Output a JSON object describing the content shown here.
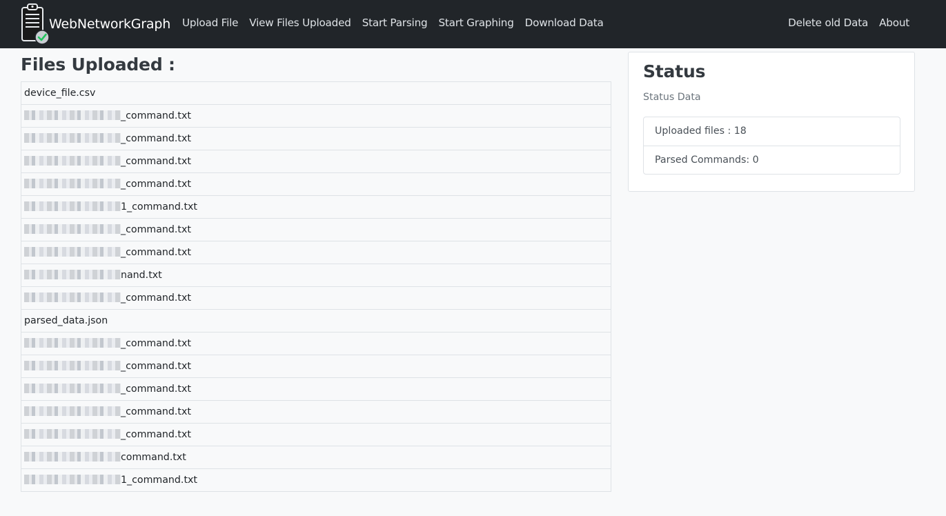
{
  "app": {
    "brand": "WebNetworkGraph",
    "brand_icon": "clipboard-check-icon"
  },
  "nav": {
    "left": [
      {
        "label": "Upload File"
      },
      {
        "label": "View Files Uploaded"
      },
      {
        "label": "Start Parsing"
      },
      {
        "label": "Start Graphing"
      },
      {
        "label": "Download Data"
      }
    ],
    "right": [
      {
        "label": "Delete old Data"
      },
      {
        "label": "About"
      }
    ]
  },
  "files": {
    "title": "Files Uploaded :",
    "rows": [
      {
        "redacted": false,
        "name": "device_file.csv"
      },
      {
        "redacted": true,
        "name": "_command.txt"
      },
      {
        "redacted": true,
        "name": "_command.txt"
      },
      {
        "redacted": true,
        "name": "_command.txt"
      },
      {
        "redacted": true,
        "name": "_command.txt"
      },
      {
        "redacted": true,
        "name": "1_command.txt"
      },
      {
        "redacted": true,
        "name": "_command.txt"
      },
      {
        "redacted": true,
        "name": "_command.txt"
      },
      {
        "redacted": true,
        "name": "nand.txt"
      },
      {
        "redacted": true,
        "name": "_command.txt"
      },
      {
        "redacted": false,
        "name": "parsed_data.json"
      },
      {
        "redacted": true,
        "name": "_command.txt"
      },
      {
        "redacted": true,
        "name": "_command.txt"
      },
      {
        "redacted": true,
        "name": "_command.txt"
      },
      {
        "redacted": true,
        "name": "_command.txt"
      },
      {
        "redacted": true,
        "name": "_command.txt"
      },
      {
        "redacted": true,
        "name": "command.txt"
      },
      {
        "redacted": true,
        "name": "1_command.txt"
      }
    ]
  },
  "status": {
    "title": "Status",
    "subtitle": "Status Data",
    "items": [
      {
        "label": "Uploaded files : 18",
        "highlighted": true
      },
      {
        "label": "Parsed Commands: 0",
        "highlighted": false
      }
    ],
    "highlight_color": "#ffff33"
  }
}
